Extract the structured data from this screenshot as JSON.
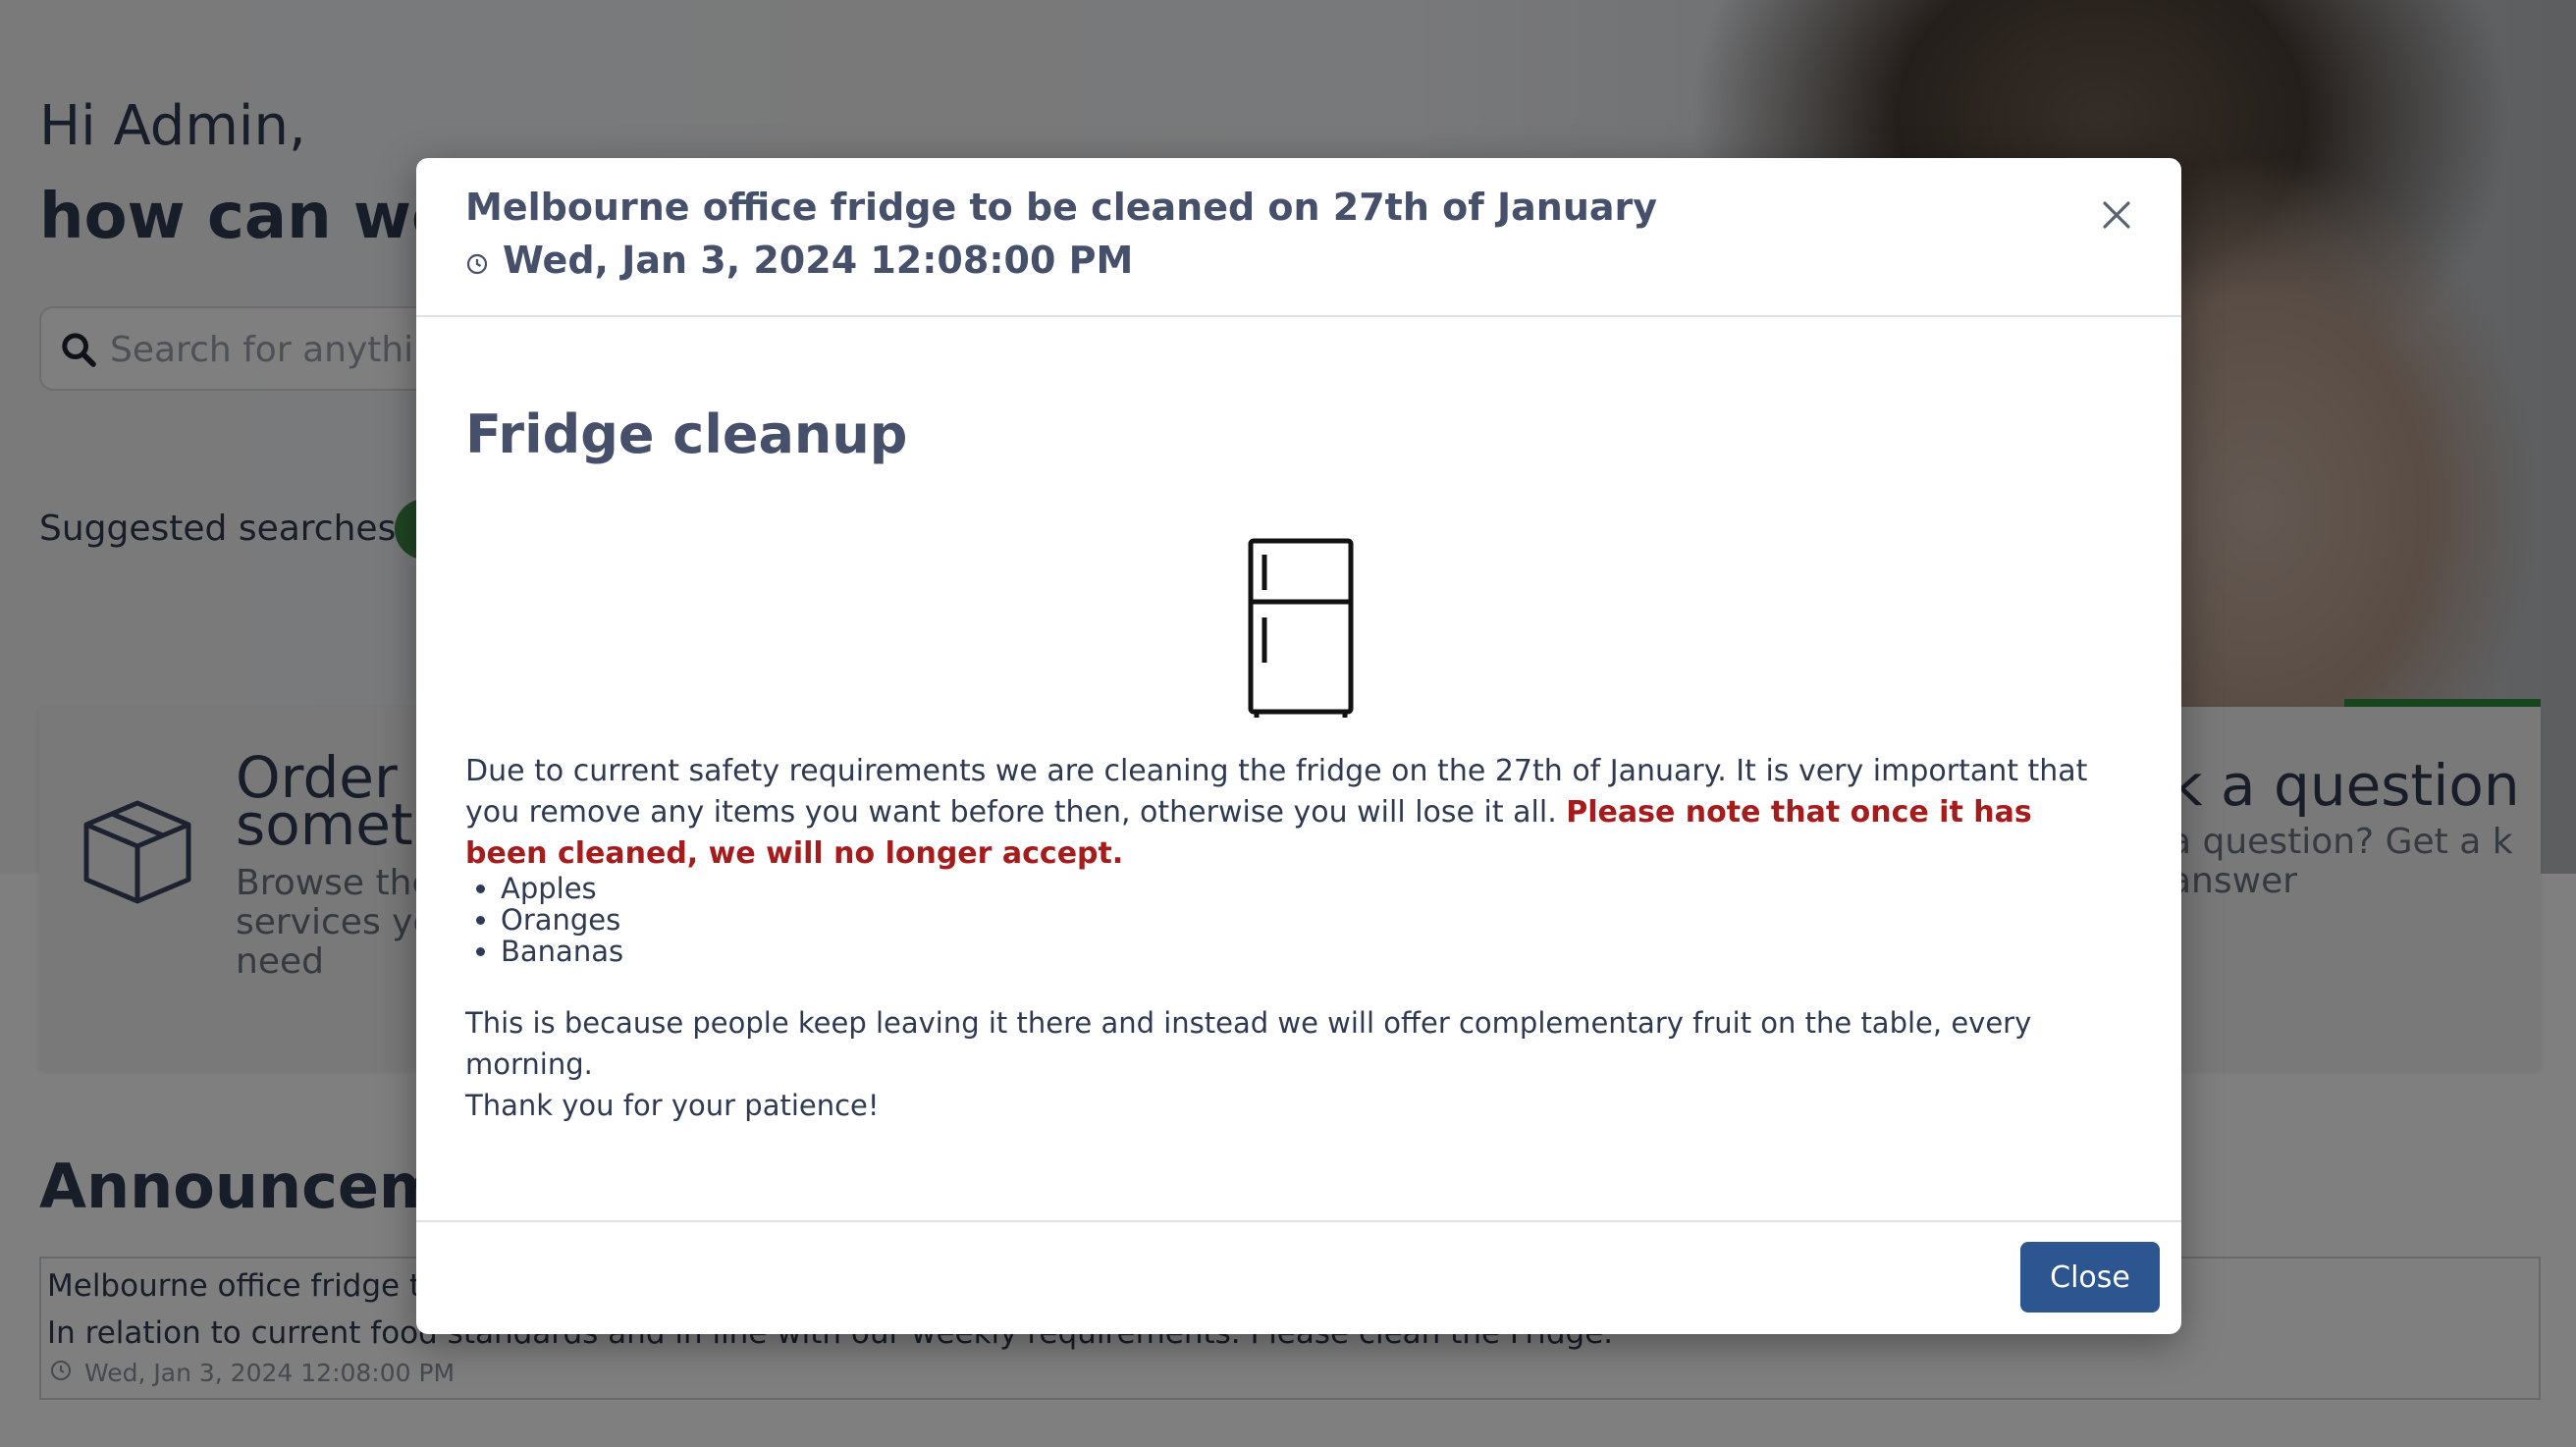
{
  "background": {
    "greeting_line1": "Hi Admin,",
    "greeting_line2": "how can we h",
    "search_placeholder": "Search for anythin",
    "suggested_label": "Suggested searches:",
    "card_order_title_line1": "Order",
    "card_order_title_line2": "someth",
    "card_order_desc": "Browse the for services you need",
    "card_ask_title": "k a question",
    "card_ask_desc": "a question? Get a k answer",
    "announcements_title": "Announceme",
    "announcement_title": "Melbourne office fridge to b",
    "announcement_body": "In relation to current food standards and in line with our weekly requirements. Please clean the Fridge.",
    "announcement_date": "Wed, Jan 3, 2024 12:08:00 PM"
  },
  "modal": {
    "title": "Melbourne office fridge to be cleaned on 27th of January",
    "date": "Wed, Jan 3, 2024 12:08:00 PM",
    "heading": "Fridge cleanup",
    "paragraph": "Due to current safety requirements we are cleaning the fridge on the 27th of January.   It is very important that you remove any items you want before then, otherwise you will lose it all.",
    "paragraph_emphasis": "Please note that once it has been cleaned, we will no longer accept.",
    "list_items": [
      "Apples",
      "Oranges",
      "Bananas"
    ],
    "note_line1": "This is because people keep leaving it there and instead we will offer complementary fruit on the table, every morning.",
    "note_line2": "Thank you for your patience!",
    "close_label": "Close"
  },
  "icons": {
    "close": "close-icon",
    "clock": "clock-icon",
    "fridge": "fridge-icon",
    "search": "search-icon",
    "box": "box-icon"
  },
  "colors": {
    "primary_button": "#2d5590",
    "emphasis_red": "#a61c1c",
    "accent_green": "#2e8b3a",
    "text_dark": "#46506a"
  }
}
